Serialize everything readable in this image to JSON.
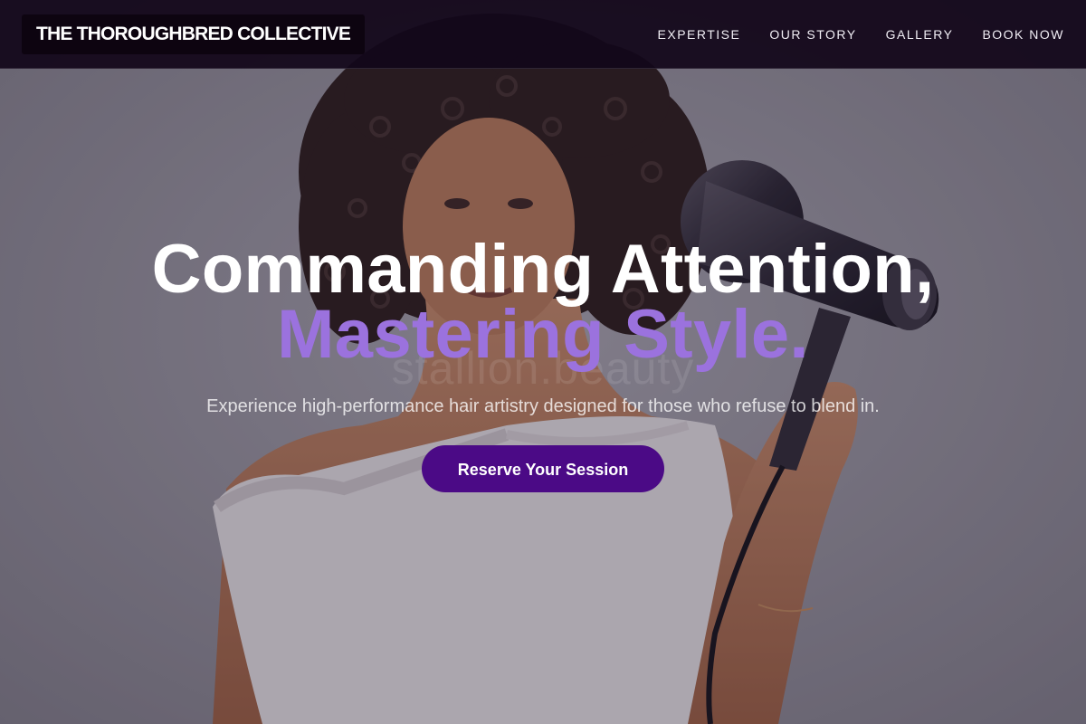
{
  "brand": {
    "name": "THE THOROUGHBRED COLLECTIVE"
  },
  "nav": {
    "items": [
      {
        "label": "EXPERTISE"
      },
      {
        "label": "OUR STORY"
      },
      {
        "label": "GALLERY"
      },
      {
        "label": "BOOK NOW"
      }
    ]
  },
  "hero": {
    "headline_line1": "Commanding Attention,",
    "headline_line2": "Mastering Style.",
    "watermark": "stallion.beauty",
    "subtitle": "Experience high-performance hair artistry designed for those who refuse to blend in.",
    "cta_label": "Reserve Your Session"
  },
  "colors": {
    "header_bg": "#12061a",
    "accent_text": "#9b72de",
    "cta_bg": "#4b0a86"
  }
}
